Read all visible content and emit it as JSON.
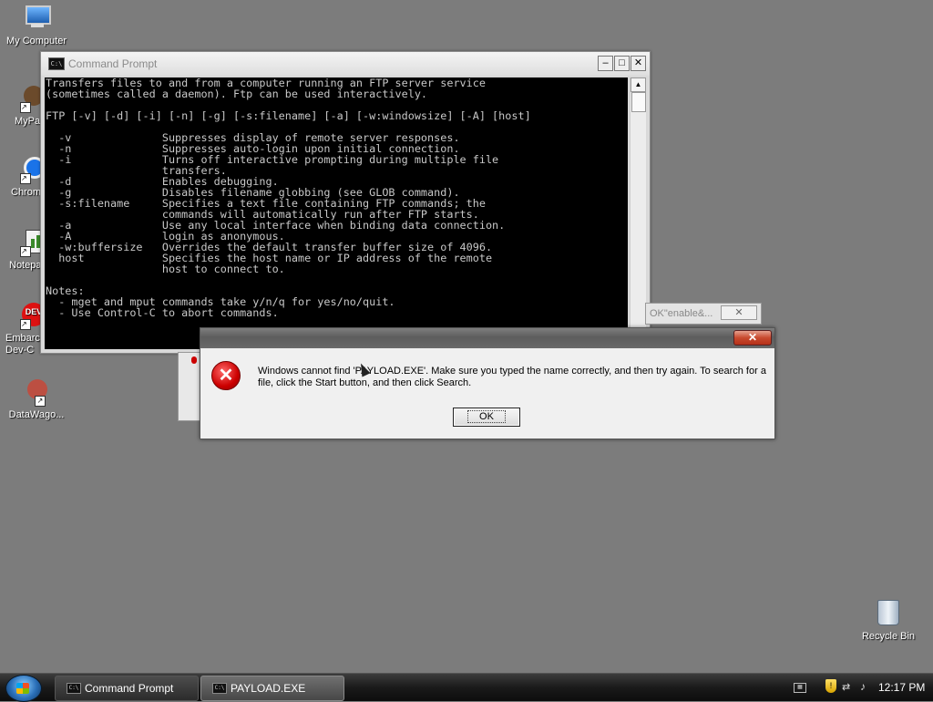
{
  "desktop": {
    "icons": [
      {
        "label": "My Computer",
        "name": "my-computer"
      },
      {
        "label": "MyPa",
        "name": "mypa"
      },
      {
        "label": "Chrom",
        "name": "chrome"
      },
      {
        "label": "Notepa",
        "name": "notepad"
      },
      {
        "label": "Embarc Dev-C",
        "name": "embarcadero-dev-cpp"
      },
      {
        "label": "DataWago...",
        "name": "datawagon"
      }
    ],
    "recycle_bin": "Recycle Bin"
  },
  "cmd": {
    "title": "Command Prompt",
    "buttons": {
      "minimize": "–",
      "maximize": "□",
      "close": "✕"
    },
    "lines": [
      "Transfers files to and from a computer running an FTP server service",
      "(sometimes called a daemon). Ftp can be used interactively.",
      "",
      "FTP [-v] [-d] [-i] [-n] [-g] [-s:filename] [-a] [-w:windowsize] [-A] [host]",
      "",
      "  -v              Suppresses display of remote server responses.",
      "  -n              Suppresses auto-login upon initial connection.",
      "  -i              Turns off interactive prompting during multiple file",
      "                  transfers.",
      "  -d              Enables debugging.",
      "  -g              Disables filename globbing (see GLOB command).",
      "  -s:filename     Specifies a text file containing FTP commands; the",
      "                  commands will automatically run after FTP starts.",
      "  -a              Use any local interface when binding data connection.",
      "  -A              login as anonymous.",
      "  -w:buffersize   Overrides the default transfer buffer size of 4096.",
      "  host            Specifies the host name or IP address of the remote",
      "                  host to connect to.",
      "",
      "Notes:",
      "  - mget and mput commands take y/n/q for yes/no/quit.",
      "  - Use Control-C to abort commands."
    ]
  },
  "bg_window": {
    "title": "OK\"enable&..."
  },
  "dialog": {
    "close": "✕",
    "icon": "error-icon",
    "message": "Windows cannot find 'PAYLOAD.EXE'. Make sure you typed the name correctly, and then try again. To search for a file, click the Start button, and then click Search.",
    "ok_label": "OK"
  },
  "taskbar": {
    "items": [
      {
        "label": "Command Prompt",
        "active": false
      },
      {
        "label": "PAYLOAD.EXE",
        "active": true
      }
    ],
    "clock": "12:17 PM"
  }
}
